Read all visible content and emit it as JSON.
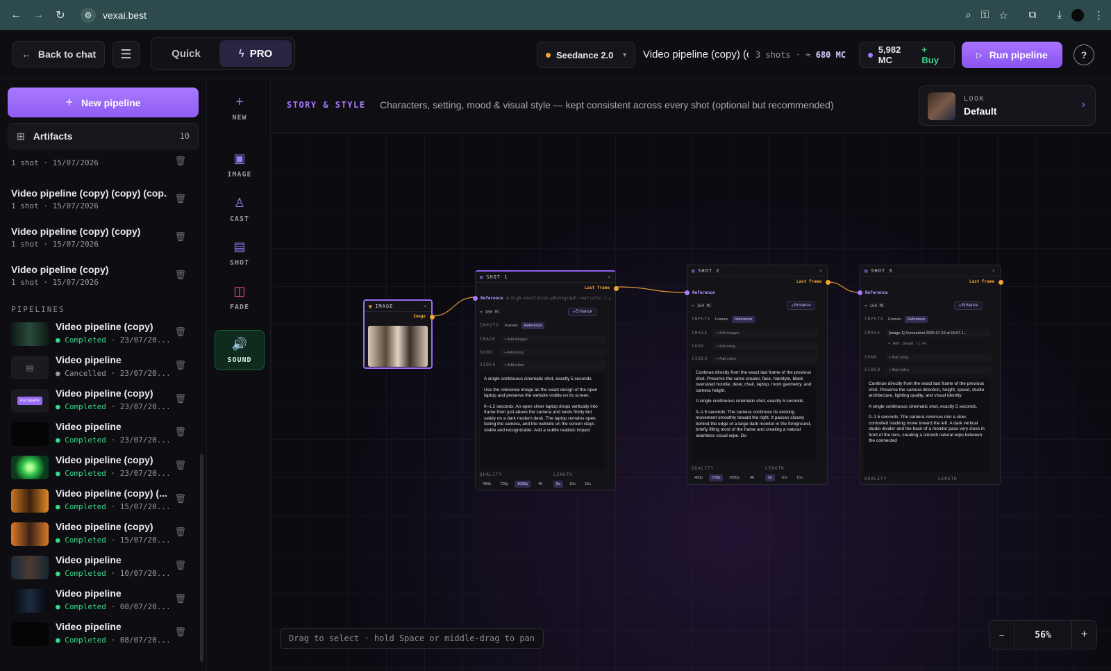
{
  "browser": {
    "url": "vexai.best"
  },
  "topbar": {
    "back_label": "Back to chat",
    "mode_quick": "Quick",
    "mode_pro": "PRO",
    "model_name": "Seedance 2.0",
    "pipeline_title": "Video pipeline (copy) (c",
    "shots_info": "3 shots · ≈",
    "shots_cost": "680 MC",
    "balance": "5,982 MC",
    "buy_label": "+ Buy",
    "run_label": "Run pipeline",
    "help": "?"
  },
  "sidebar": {
    "new_pipeline": "New pipeline",
    "artifacts_label": "Artifacts",
    "artifacts_count": "10",
    "history": [
      {
        "title": "",
        "sub": "1 shot · 15/07/2026"
      },
      {
        "title": "Video pipeline (copy) (copy) (cop...",
        "sub": "1 shot · 15/07/2026"
      },
      {
        "title": "Video pipeline (copy) (copy)",
        "sub": "1 shot · 15/07/2026"
      },
      {
        "title": "Video pipeline (copy)",
        "sub": "1 shot · 15/07/2026"
      }
    ],
    "section_label": "PIPELINES",
    "pipelines": [
      {
        "title": "Video pipeline (copy)",
        "status": "Completed",
        "date": "· 23/07/20..."
      },
      {
        "title": "Video pipeline",
        "status": "Cancelled",
        "date": "· 23/07/20..."
      },
      {
        "title": "Video pipeline (copy)",
        "status": "Completed",
        "date": "· 23/07/20..."
      },
      {
        "title": "Video pipeline",
        "status": "Completed",
        "date": "· 23/07/20..."
      },
      {
        "title": "Video pipeline (copy)",
        "status": "Completed",
        "date": "· 23/07/20..."
      },
      {
        "title": "Video pipeline (copy) (...",
        "status": "Completed",
        "date": "· 15/07/20..."
      },
      {
        "title": "Video pipeline (copy)",
        "status": "Completed",
        "date": "· 15/07/20..."
      },
      {
        "title": "Video pipeline",
        "status": "Completed",
        "date": "· 10/07/20..."
      },
      {
        "title": "Video pipeline",
        "status": "Completed",
        "date": "· 08/07/20..."
      },
      {
        "title": "Video pipeline",
        "status": "Completed",
        "date": "· 08/07/20..."
      }
    ],
    "thumb_run_label": "Run pipeline"
  },
  "rail": {
    "new": "NEW",
    "image": "IMAGE",
    "cast": "CAST",
    "shot": "SHOT",
    "fade": "FADE",
    "sound": "SOUND"
  },
  "story": {
    "tag": "STORY & STYLE",
    "desc": "Characters, setting, mood & visual style — kept consistent across every shot (optional but recommended)",
    "look_key": "LOOK",
    "look_value": "Default"
  },
  "canvas": {
    "image_node": {
      "title": "IMAGE",
      "port": "Image"
    },
    "shots": [
      {
        "title": "SHOT 1",
        "last_frame": "Last frame",
        "reference": "Reference",
        "ref_text": "A-high-resolution-photograph-realistic-l.p",
        "cost": "≈ 160 MC",
        "enhance": "Enhance",
        "inputs": "INPUTS",
        "tab_frames": "Frames",
        "tab_reference": "Reference",
        "image_label": "IMAGE",
        "image_value": "+ Add images",
        "song_label": "SONG",
        "song_value": "+ Add song",
        "video_label": "VIDEO",
        "video_value": "+ Add video",
        "prompt": [
          "A single continuous cinematic shot, exactly 5 seconds.",
          "Use the reference image as the exact design of the open laptop and preserve the website visible on its screen.",
          "0–1.2 seconds: An open silver laptop drops vertically into frame from just above the camera and lands firmly but safely on a dark modern desk. The laptop remains open, facing the camera, and the website on the screen stays stable and recognizable. Add a subtle realistic impact"
        ],
        "quality": "QUALITY",
        "length": "LENGTH",
        "q_opts": [
          "480p",
          "720p",
          "1080p",
          "4K"
        ],
        "q_sel": 2,
        "l_opts": [
          "5s",
          "10s",
          "15s"
        ],
        "l_sel": 0
      },
      {
        "title": "SHOT 2",
        "last_frame": "Last frame",
        "reference": "Reference",
        "cost": "≈ 160 MC",
        "enhance": "Enhance",
        "inputs": "INPUTS",
        "tab_frames": "Frames",
        "tab_reference": "Reference",
        "image_label": "IMAGE",
        "image_value": "+ Add images",
        "song_label": "SONG",
        "song_value": "+ Add song",
        "video_label": "VIDEO",
        "video_value": "+ Add video",
        "prompt": [
          "Continue directly from the exact last frame of the previous shot. Preserve the same creator, face, hairstyle, black oversized hoodie, desk, chair, laptop, room geometry, and camera height.",
          "A single continuous cinematic shot, exactly 5 seconds.",
          "0–1.5 seconds: The camera continues its existing movement smoothly toward the right. It passes closely behind the edge of a large dark monitor in the foreground, briefly filling most of the frame and creating a natural seamless visual wipe. Do"
        ],
        "quality": "QUALITY",
        "length": "LENGTH",
        "q_opts": [
          "480p",
          "720p",
          "1080p",
          "4K"
        ],
        "q_sel": 1,
        "l_opts": [
          "5s",
          "10s",
          "15s"
        ],
        "l_sel": 0
      },
      {
        "title": "SHOT 3",
        "last_frame": "Last frame",
        "reference": "Reference",
        "cost": "≈ 160 MC",
        "enhance": "Enhance",
        "inputs": "INPUTS",
        "tab_frames": "Frames",
        "tab_reference": "Reference",
        "image_label": "IMAGE",
        "image_value": "[image 1] Screenshot 2026-07-23 at 15.07.1...",
        "image_add": "+ Add image (1/4)",
        "song_label": "SONG",
        "song_value": "+ Add song",
        "video_label": "VIDEO",
        "video_value": "+ Add video",
        "prompt": [
          "Continue directly from the exact last frame of the previous shot. Preserve the camera direction, height, speed, studio architecture, lighting quality, and visual identity.",
          "A single continuous cinematic shot, exactly 5 seconds.",
          "0–1.5 seconds: The camera reverses into a slow, controlled tracking move toward the left. A dark vertical studio divider and the back of a monitor pass very close in front of the lens, creating a smooth natural wipe between the connected"
        ],
        "quality": "QUALITY",
        "length": "LENGTH"
      }
    ],
    "hint": "Drag to select · hold Space or middle-drag to pan",
    "zoom_minus": "−",
    "zoom_value": "56%",
    "zoom_plus": "+"
  }
}
